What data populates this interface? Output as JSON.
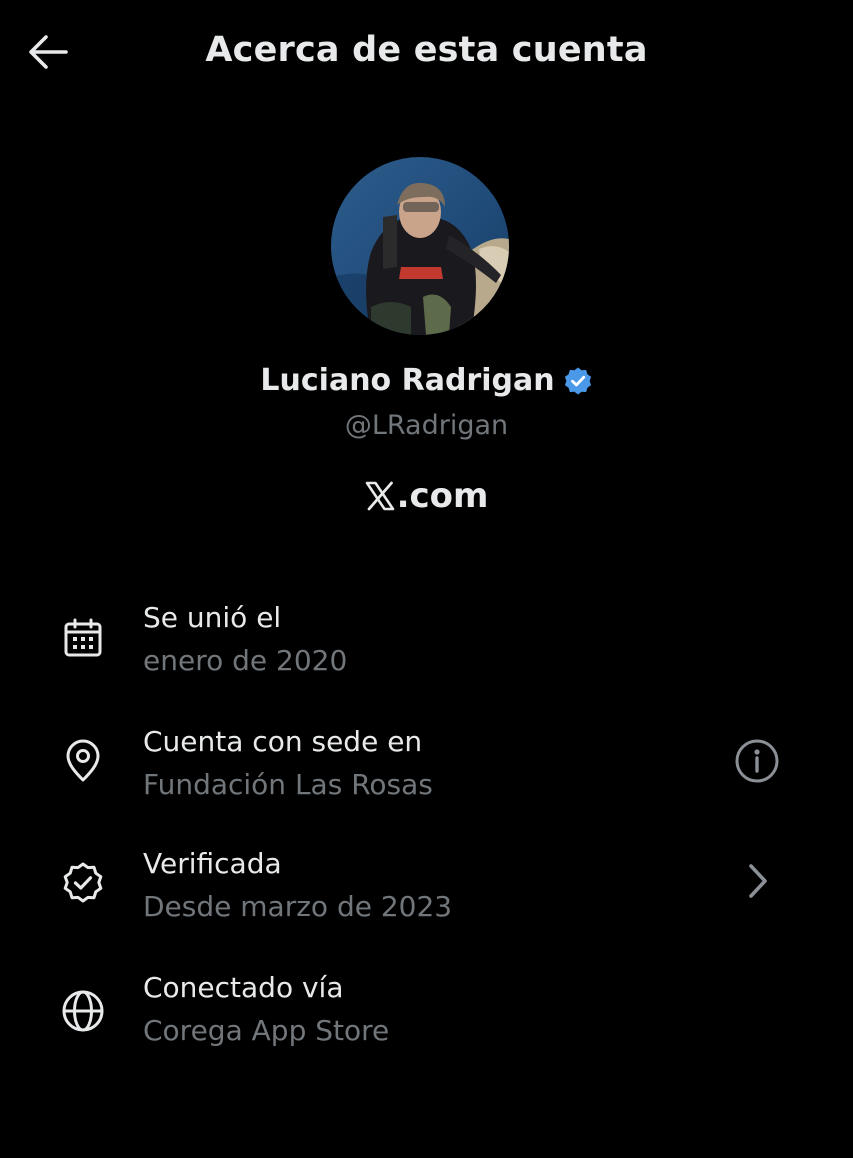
{
  "header": {
    "title": "Acerca de esta cuenta",
    "back_icon": "arrow-left-icon"
  },
  "profile": {
    "display_name": "Luciano Radrigan",
    "handle": "@LRadrigan",
    "verified_badge_icon": "verified-badge-icon",
    "verified_color": "#4a99e9",
    "brand_logo_icon": "x-logo-icon",
    "brand_text": ".com"
  },
  "rows": [
    {
      "icon": "calendar-icon",
      "label": "Se unió el",
      "value": "enero de 2020"
    },
    {
      "icon": "location-pin-icon",
      "label": "Cuenta con sede en",
      "value": "Fundación Las Rosas",
      "trailing_icon": "info-icon"
    },
    {
      "icon": "verified-check-icon",
      "label": "Verificada",
      "value": "Desde marzo de 2023",
      "trailing_icon": "chevron-right-icon"
    },
    {
      "icon": "globe-icon",
      "label": "Conectado vía",
      "value": "Corega App Store"
    }
  ],
  "colors": {
    "background": "#000000",
    "primary_text": "#e7e9ea",
    "secondary_text": "#71767b",
    "accent": "#4a99e9"
  }
}
